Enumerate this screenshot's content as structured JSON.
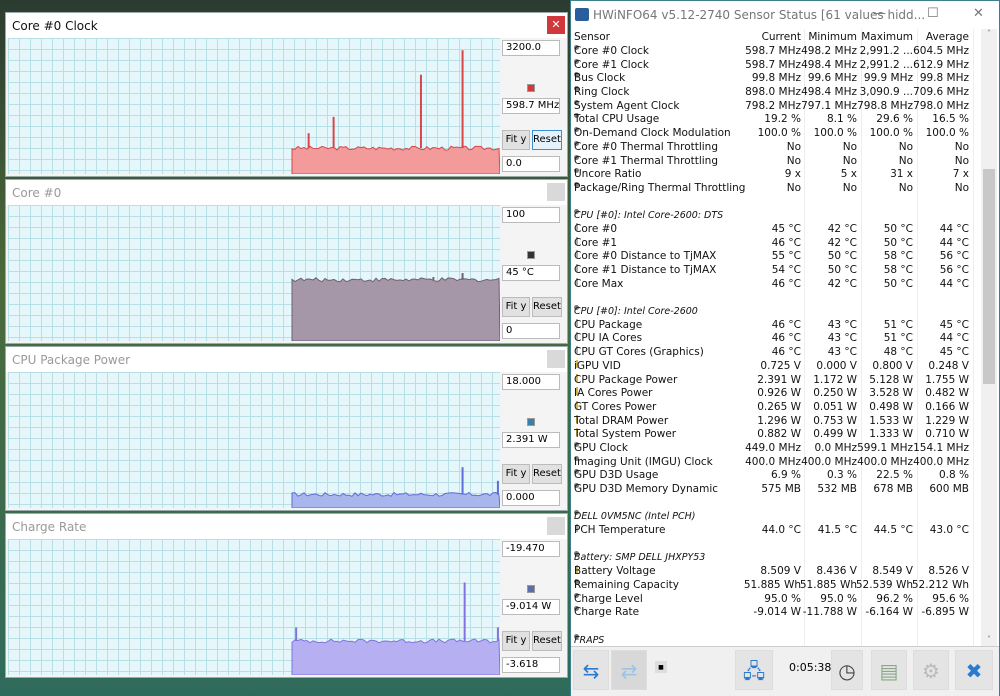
{
  "graphs": [
    {
      "title": "Core #0 Clock",
      "max": "3200.0",
      "current": "598.7 MHz",
      "min": "0.0",
      "fit": "Fit y",
      "reset": "Reset",
      "color": "#f39a9a",
      "line": "#d6474b",
      "swatch": "#d0383c",
      "level": 0.19,
      "spikes": [
        [
          0.08,
          0.3
        ],
        [
          0.2,
          0.42
        ],
        [
          0.62,
          0.73
        ],
        [
          0.82,
          0.91
        ]
      ],
      "active": true
    },
    {
      "title": "Core #0",
      "max": "100",
      "current": "45 °C",
      "min": "0",
      "fit": "Fit y",
      "reset": "Reset",
      "color": "#a597a8",
      "line": "#6e5f73",
      "swatch": "#333333",
      "level": 0.45,
      "spikes": [
        [
          0.68,
          0.47
        ],
        [
          0.82,
          0.5
        ]
      ],
      "active": false
    },
    {
      "title": "CPU Package Power",
      "max": "18.000",
      "current": "2.391 W",
      "min": "0.000",
      "fit": "Fit y",
      "reset": "Reset",
      "color": "#a9b6ee",
      "line": "#5b6fd6",
      "swatch": "#3a7fa8",
      "level": 0.1,
      "spikes": [
        [
          0.82,
          0.3
        ],
        [
          0.99,
          0.2
        ]
      ],
      "active": false
    },
    {
      "title": "Charge Rate",
      "max": "-19.470",
      "current": "-9.014 W",
      "min": "-3.618",
      "fit": "Fit y",
      "reset": "Reset",
      "color": "#b6b0f2",
      "line": "#7e74de",
      "swatch": "#5a6fa8",
      "level": 0.25,
      "spikes": [
        [
          0.02,
          0.35
        ],
        [
          0.83,
          0.68
        ],
        [
          0.99,
          0.35
        ]
      ],
      "active": false
    }
  ],
  "hwinfo": {
    "title": "HWiNFO64 v5.12-2740 Sensor Status [61 values hidd...",
    "headers": [
      "Sensor",
      "Current",
      "Minimum",
      "Maximum",
      "Average"
    ],
    "rows": [
      {
        "t": "d",
        "n": "Core #0 Clock",
        "v": [
          "598.7 MHz",
          "498.2 MHz",
          "2,991.2 ...",
          "604.5 MHz"
        ]
      },
      {
        "t": "d",
        "n": "Core #1 Clock",
        "v": [
          "598.7 MHz",
          "498.4 MHz",
          "2,991.2 ...",
          "612.9 MHz"
        ]
      },
      {
        "t": "d",
        "n": "Bus Clock",
        "v": [
          "99.8 MHz",
          "99.6 MHz",
          "99.9 MHz",
          "99.8 MHz"
        ]
      },
      {
        "t": "d",
        "n": "Ring Clock",
        "v": [
          "898.0 MHz",
          "498.4 MHz",
          "3,090.9 ...",
          "709.6 MHz"
        ]
      },
      {
        "t": "d",
        "n": "System Agent Clock",
        "v": [
          "798.2 MHz",
          "797.1 MHz",
          "798.8 MHz",
          "798.0 MHz"
        ]
      },
      {
        "t": "d",
        "n": "Total CPU Usage",
        "v": [
          "19.2 %",
          "8.1 %",
          "29.6 %",
          "16.5 %"
        ]
      },
      {
        "t": "d",
        "n": "On-Demand Clock Modulation",
        "v": [
          "100.0 %",
          "100.0 %",
          "100.0 %",
          "100.0 %"
        ]
      },
      {
        "t": "d",
        "n": "Core #0 Thermal Throttling",
        "v": [
          "No",
          "No",
          "No",
          "No"
        ]
      },
      {
        "t": "d",
        "n": "Core #1 Thermal Throttling",
        "v": [
          "No",
          "No",
          "No",
          "No"
        ]
      },
      {
        "t": "d",
        "n": "Uncore Ratio",
        "v": [
          "9 x",
          "5 x",
          "31 x",
          "7 x"
        ]
      },
      {
        "t": "d",
        "n": "Package/Ring Thermal Throttling",
        "v": [
          "No",
          "No",
          "No",
          "No"
        ]
      },
      {
        "t": "b"
      },
      {
        "t": "s",
        "n": "CPU [#0]: Intel Core-2600: DTS"
      },
      {
        "t": "t",
        "n": "Core #0",
        "v": [
          "45 °C",
          "42 °C",
          "50 °C",
          "44 °C"
        ]
      },
      {
        "t": "t",
        "n": "Core #1",
        "v": [
          "46 °C",
          "42 °C",
          "50 °C",
          "44 °C"
        ]
      },
      {
        "t": "t",
        "n": "Core #0 Distance to TjMAX",
        "v": [
          "55 °C",
          "50 °C",
          "58 °C",
          "56 °C"
        ]
      },
      {
        "t": "t",
        "n": "Core #1 Distance to TjMAX",
        "v": [
          "54 °C",
          "50 °C",
          "58 °C",
          "56 °C"
        ]
      },
      {
        "t": "t",
        "n": "Core Max",
        "v": [
          "46 °C",
          "42 °C",
          "50 °C",
          "44 °C"
        ]
      },
      {
        "t": "b"
      },
      {
        "t": "s",
        "n": "CPU [#0]: Intel Core-2600"
      },
      {
        "t": "t",
        "n": "CPU Package",
        "v": [
          "46 °C",
          "43 °C",
          "51 °C",
          "45 °C"
        ]
      },
      {
        "t": "t",
        "n": "CPU IA Cores",
        "v": [
          "46 °C",
          "43 °C",
          "51 °C",
          "44 °C"
        ]
      },
      {
        "t": "t",
        "n": "CPU GT Cores (Graphics)",
        "v": [
          "46 °C",
          "43 °C",
          "48 °C",
          "45 °C"
        ]
      },
      {
        "t": "p",
        "n": "iGPU VID",
        "v": [
          "0.725 V",
          "0.000 V",
          "0.800 V",
          "0.248 V"
        ]
      },
      {
        "t": "p",
        "n": "CPU Package Power",
        "v": [
          "2.391 W",
          "1.172 W",
          "5.128 W",
          "1.755 W"
        ]
      },
      {
        "t": "p",
        "n": "IA Cores Power",
        "v": [
          "0.926 W",
          "0.250 W",
          "3.528 W",
          "0.482 W"
        ]
      },
      {
        "t": "p",
        "n": "GT Cores Power",
        "v": [
          "0.265 W",
          "0.051 W",
          "0.498 W",
          "0.166 W"
        ]
      },
      {
        "t": "p",
        "n": "Total DRAM Power",
        "v": [
          "1.296 W",
          "0.753 W",
          "1.533 W",
          "1.229 W"
        ]
      },
      {
        "t": "p",
        "n": "Total System Power",
        "v": [
          "0.882 W",
          "0.499 W",
          "1.333 W",
          "0.710 W"
        ]
      },
      {
        "t": "d",
        "n": "GPU Clock",
        "v": [
          "449.0 MHz",
          "0.0 MHz",
          "599.1 MHz",
          "154.1 MHz"
        ]
      },
      {
        "t": "d",
        "n": "Imaging Unit (IMGU) Clock",
        "v": [
          "400.0 MHz",
          "400.0 MHz",
          "400.0 MHz",
          "400.0 MHz"
        ]
      },
      {
        "t": "d",
        "n": "GPU D3D Usage",
        "v": [
          "6.9 %",
          "0.3 %",
          "22.5 %",
          "0.8 %"
        ]
      },
      {
        "t": "d",
        "n": "GPU D3D Memory Dynamic",
        "v": [
          "575 MB",
          "532 MB",
          "678 MB",
          "600 MB"
        ]
      },
      {
        "t": "b"
      },
      {
        "t": "s",
        "n": "DELL 0VM5NC (Intel PCH)"
      },
      {
        "t": "t",
        "n": "PCH Temperature",
        "v": [
          "44.0 °C",
          "41.5 °C",
          "44.5 °C",
          "43.0 °C"
        ]
      },
      {
        "t": "b"
      },
      {
        "t": "s",
        "n": "Battery: SMP DELL JHXPY53"
      },
      {
        "t": "p",
        "n": "Battery Voltage",
        "v": [
          "8.509 V",
          "8.436 V",
          "8.549 V",
          "8.526 V"
        ]
      },
      {
        "t": "d",
        "n": "Remaining Capacity",
        "v": [
          "51.885 Wh",
          "51.885 Wh",
          "52.539 Wh",
          "52.212 Wh"
        ]
      },
      {
        "t": "d",
        "n": "Charge Level",
        "v": [
          "95.0 %",
          "95.0 %",
          "96.2 %",
          "95.6 %"
        ]
      },
      {
        "t": "d",
        "n": "Charge Rate",
        "v": [
          "-9.014 W",
          "-11.788 W",
          "-6.164 W",
          "-6.895 W"
        ]
      },
      {
        "t": "b"
      },
      {
        "t": "s",
        "n": "FRAPS"
      }
    ],
    "timer": "0:05:38"
  }
}
